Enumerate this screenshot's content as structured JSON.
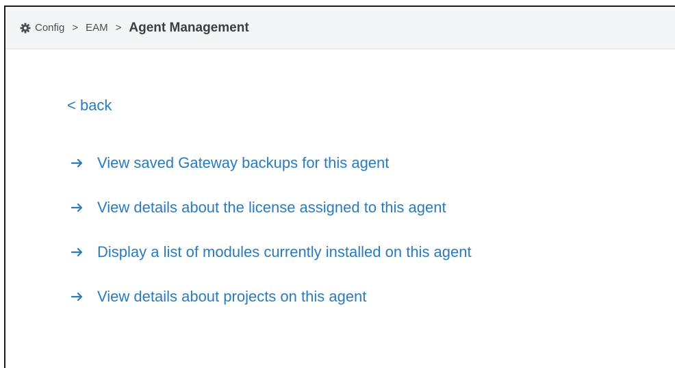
{
  "breadcrumb": {
    "icon": "gear-icon",
    "items": [
      "Config",
      "EAM"
    ],
    "separator": ">",
    "current": "Agent Management"
  },
  "back": {
    "label": "< back"
  },
  "links": [
    {
      "icon": "arrow-right-icon",
      "label": "View saved Gateway backups for this agent"
    },
    {
      "icon": "arrow-right-icon",
      "label": "View details about the license assigned to this agent"
    },
    {
      "icon": "arrow-right-icon",
      "label": "Display a list of modules currently installed on this agent"
    },
    {
      "icon": "arrow-right-icon",
      "label": "View details about projects on this agent"
    }
  ],
  "colors": {
    "link": "#2a7bbd",
    "header_bg": "#f4f5f6",
    "breadcrumb_text": "#4a4f55"
  }
}
